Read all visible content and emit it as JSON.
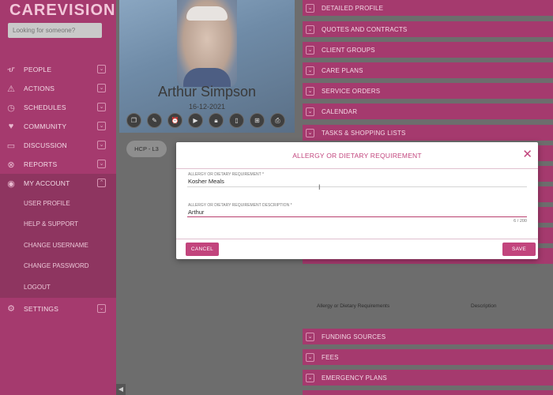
{
  "app": {
    "logo": "CAREVISION",
    "search_placeholder": "Looking for someone?"
  },
  "sidebar": {
    "items": [
      {
        "label": "PEOPLE",
        "icon": "people-icon"
      },
      {
        "label": "ACTIONS",
        "icon": "warning-icon"
      },
      {
        "label": "SCHEDULES",
        "icon": "clock-icon"
      },
      {
        "label": "COMMUNITY",
        "icon": "heart-icon"
      },
      {
        "label": "DISCUSSION",
        "icon": "chat-icon"
      },
      {
        "label": "REPORTS",
        "icon": "reports-icon"
      },
      {
        "label": "MY ACCOUNT",
        "icon": "account-icon"
      }
    ],
    "account_sub": [
      "USER PROFILE",
      "HELP & SUPPORT",
      "CHANGE USERNAME",
      "CHANGE PASSWORD",
      "LOGOUT"
    ],
    "settings": {
      "label": "SETTINGS",
      "icon": "gear-icon"
    }
  },
  "profile": {
    "name": "Arthur Simpson",
    "dob": "16-12-2021",
    "tag": "HCP - L3"
  },
  "sections_top": [
    "DETAILED PROFILE",
    "QUOTES AND CONTRACTS",
    "CLIENT GROUPS",
    "CARE PLANS",
    "SERVICE ORDERS",
    "CALENDAR",
    "TASKS & SHOPPING LISTS"
  ],
  "table": {
    "col1": "Allergy or Dietary Requirements",
    "col2": "Description"
  },
  "sections_bottom": [
    "FUNDING SOURCES",
    "FEES",
    "EMERGENCY PLANS"
  ],
  "modal": {
    "title": "ALLERGY OR DIETARY REQUIREMENT",
    "field1_label": "ALLERGY OR DIETARY REQUIREMENT *",
    "field1_value": "Kosher Meals",
    "field2_label": "ALLERGY OR DIETARY REQUIREMENT DESCRIPTION *",
    "field2_value": "Arthur",
    "counter": "6 / 200",
    "cancel": "CANCEL",
    "save": "SAVE"
  },
  "colors": {
    "accent": "#a53a6e",
    "accent_dark": "#8e3560",
    "modal_accent": "#c2457d"
  }
}
